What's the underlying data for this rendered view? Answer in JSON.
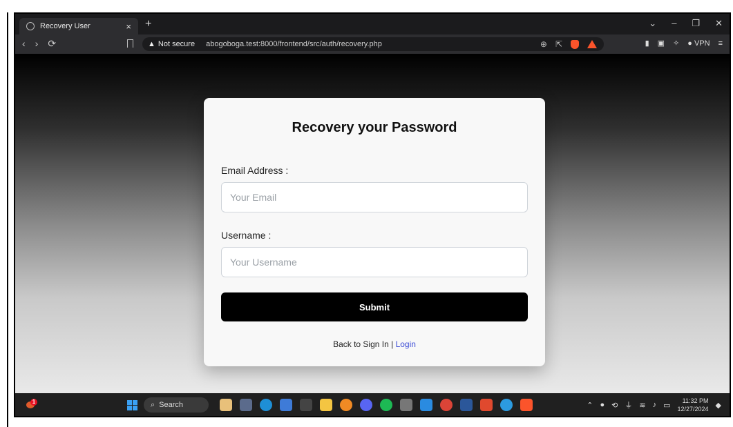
{
  "browser": {
    "tab_title": "Recovery User",
    "tab_close": "×",
    "new_tab": "+",
    "security_label": "Not secure",
    "url": "abogoboga.test:8000/frontend/src/auth/recovery.php",
    "vpn_label": "VPN",
    "window_controls": [
      "⌄",
      "–",
      "❐",
      "✕"
    ]
  },
  "page": {
    "title": "Recovery your Password",
    "email_label": "Email Address :",
    "email_placeholder": "Your Email",
    "username_label": "Username :",
    "username_placeholder": "Your Username",
    "submit_label": "Submit",
    "back_text": "Back to Sign In | ",
    "login_link": "Login"
  },
  "taskbar": {
    "search_label": "Search",
    "weather_badge": "1",
    "time": "11:32 PM",
    "date": "12/27/2024"
  },
  "colors": {
    "accent_link": "#3b4bd6",
    "submit_bg": "#000000",
    "brave_orange": "#fb542b"
  }
}
